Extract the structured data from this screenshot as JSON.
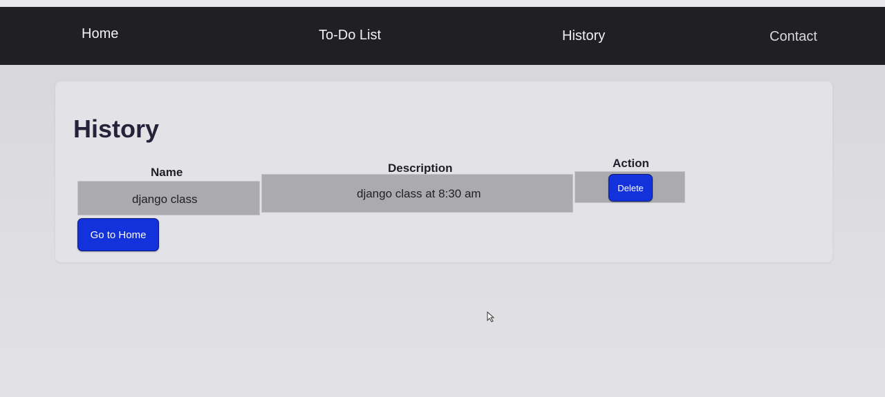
{
  "nav": {
    "home": "Home",
    "todo": "To-Do List",
    "history": "History",
    "contact": "Contact"
  },
  "page": {
    "title": "History"
  },
  "table": {
    "headers": [
      "Name",
      "Description",
      "Action"
    ],
    "rows": [
      {
        "name": "django class",
        "description": "django class at 8:30 am",
        "action": "Delete"
      }
    ]
  },
  "buttons": {
    "go_home": "Go to Home"
  },
  "colors": {
    "navbar": "#202024",
    "button": "#1432dc",
    "table_cell": "#ababae"
  }
}
